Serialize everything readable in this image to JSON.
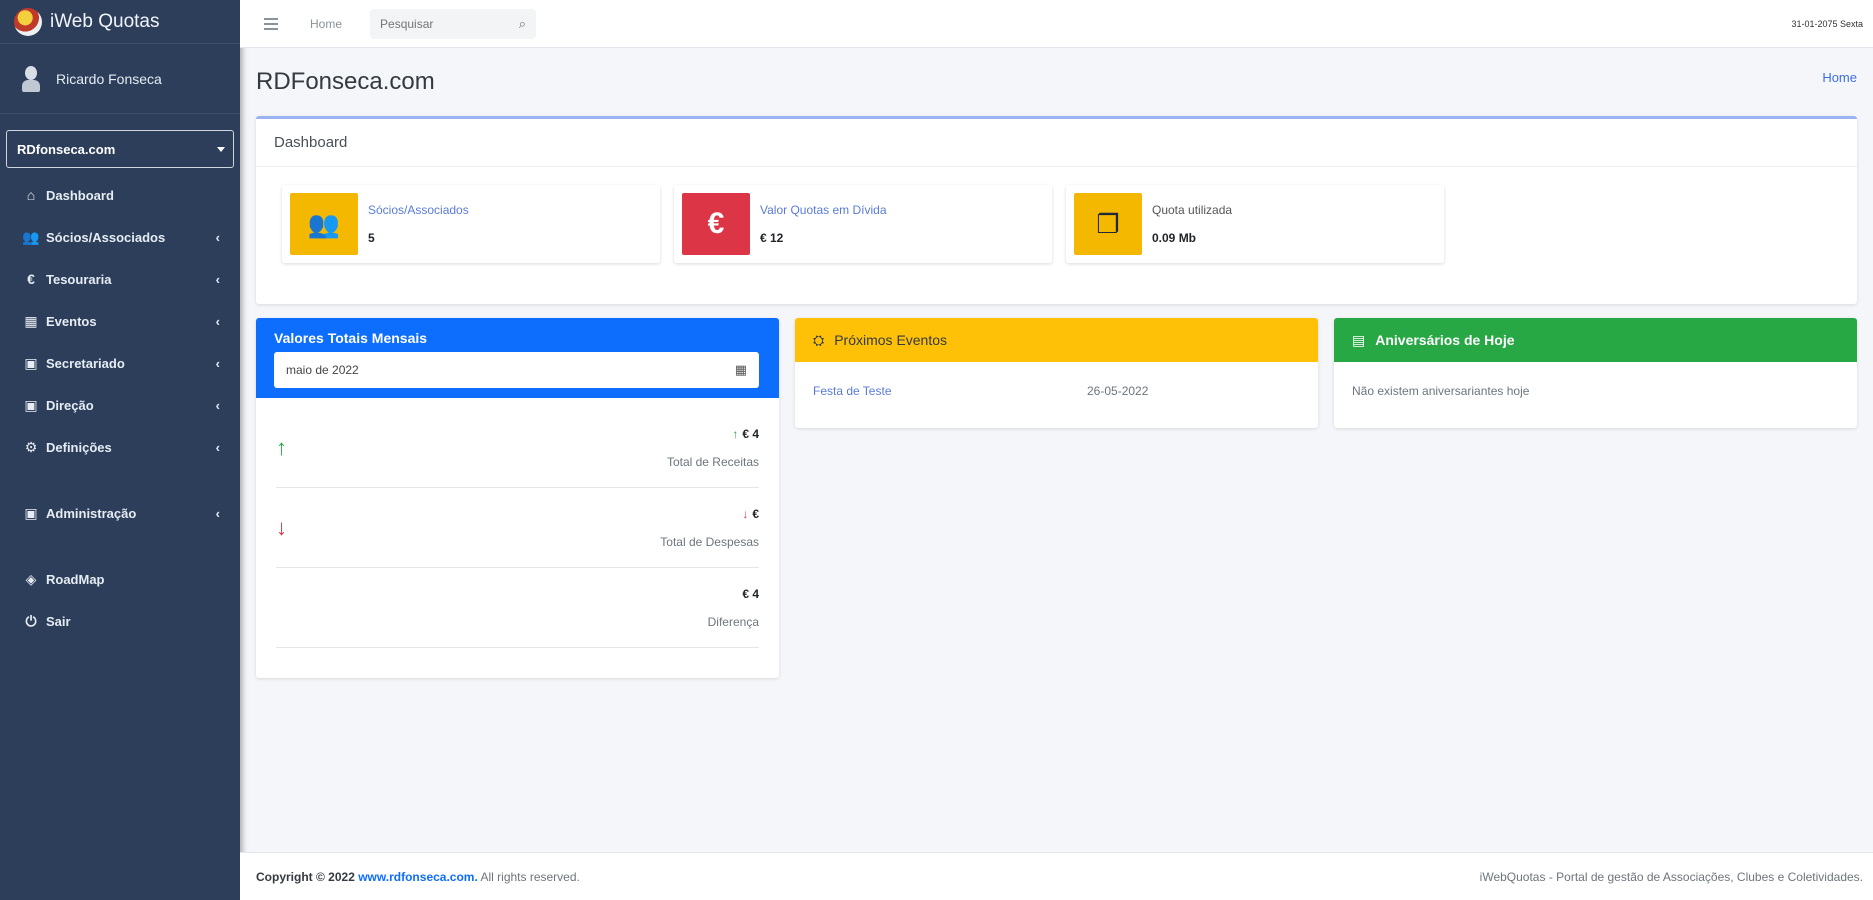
{
  "app": {
    "brand": "iWeb Quotas"
  },
  "user": {
    "name": "Ricardo Fonseca"
  },
  "org_select": {
    "value": "RDfonseca.com"
  },
  "sidebar": {
    "items": [
      {
        "label": "Dashboard",
        "icon": "home-icon"
      },
      {
        "label": "Sócios/Associados",
        "icon": "users-icon"
      },
      {
        "label": "Tesouraria",
        "icon": "euro-icon"
      },
      {
        "label": "Eventos",
        "icon": "calendar-icon"
      },
      {
        "label": "Secretariado",
        "icon": "briefcase-icon"
      },
      {
        "label": "Direção",
        "icon": "briefcase-icon"
      },
      {
        "label": "Definições",
        "icon": "gears-icon"
      },
      {
        "label": "Administração",
        "icon": "toolbox-icon"
      },
      {
        "label": "RoadMap",
        "icon": "roadmap-icon"
      },
      {
        "label": "Sair",
        "icon": "power-icon"
      }
    ]
  },
  "topbar": {
    "home": "Home",
    "search_placeholder": "Pesquisar",
    "date": "31-01-2075 Sexta"
  },
  "page": {
    "title": "RDFonseca.com",
    "breadcrumb": "Home"
  },
  "dashboard": {
    "title": "Dashboard",
    "boxes": [
      {
        "label": "Sócios/Associados",
        "value": "5"
      },
      {
        "label": "Valor Quotas em Dívida",
        "value": "€ 12"
      },
      {
        "label": "Quota utilizada",
        "value": "0.09 Mb"
      }
    ]
  },
  "totais": {
    "title": "Valores Totais Mensais",
    "month": "maio de 2022",
    "rows": [
      {
        "value": "€ 4",
        "label": "Total de Receitas"
      },
      {
        "value": "€",
        "label": "Total de Despesas"
      },
      {
        "value": "€ 4",
        "label": "Diferença"
      }
    ]
  },
  "eventos": {
    "title": "Próximos Eventos",
    "items": [
      {
        "name": "Festa de Teste",
        "date": "26-05-2022"
      }
    ]
  },
  "aniversarios": {
    "title": "Aniversários de Hoje",
    "empty": "Não existem aniversariantes hoje"
  },
  "footer": {
    "copyright": "Copyright © 2022",
    "link": "www.rdfonseca.com.",
    "rights": "All rights reserved.",
    "right_text": "iWebQuotas - Portal de gestão de Associações, Clubes e Coletividades."
  },
  "colors": {
    "sidebar": "#2c3e5a",
    "primary": "#0d6efd",
    "warning": "#ffc107",
    "success": "#28a745",
    "danger": "#dc3545"
  }
}
